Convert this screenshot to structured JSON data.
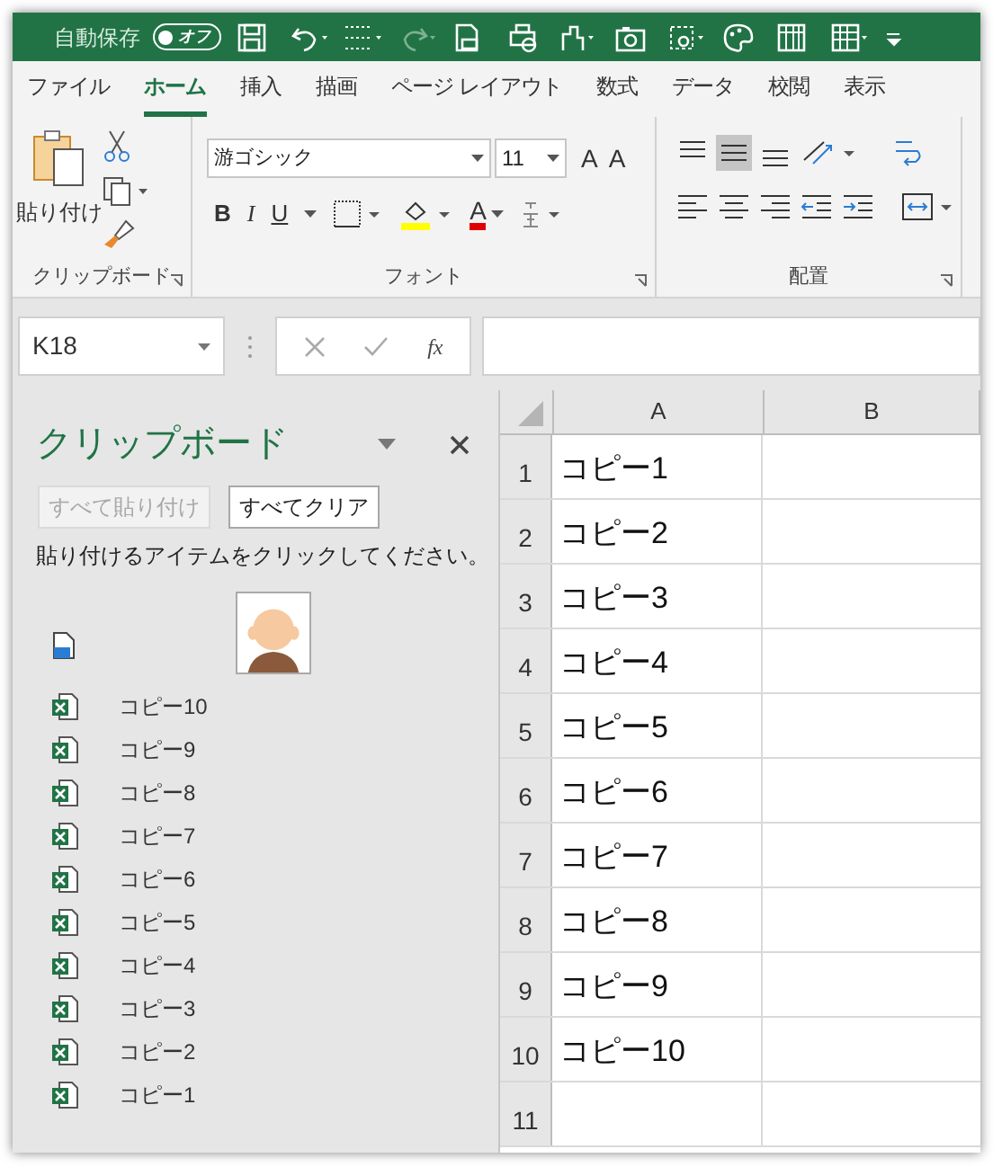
{
  "title_bar": {
    "autosave_label": "自動保存",
    "autosave_toggle": {
      "label": "オフ",
      "on": false
    }
  },
  "tabs": [
    {
      "label": "ファイル",
      "selected": false
    },
    {
      "label": "ホーム",
      "selected": true
    },
    {
      "label": "挿入",
      "selected": false
    },
    {
      "label": "描画",
      "selected": false
    },
    {
      "label": "ページ レイアウト",
      "selected": false
    },
    {
      "label": "数式",
      "selected": false
    },
    {
      "label": "データ",
      "selected": false
    },
    {
      "label": "校閲",
      "selected": false
    },
    {
      "label": "表示",
      "selected": false
    }
  ],
  "ribbon": {
    "clipboard": {
      "paste_label": "貼り付け",
      "group_label": "クリップボード"
    },
    "font": {
      "font_name": "游ゴシック",
      "font_size": "11",
      "grow": "A",
      "shrink": "A",
      "bold": "B",
      "italic": "I",
      "underline": "U",
      "font_color": "A",
      "group_label": "フォント"
    },
    "alignment": {
      "group_label": "配置"
    }
  },
  "formula_bar": {
    "name_box": "K18",
    "fx": "fx"
  },
  "clipboard_pane": {
    "title": "クリップボード",
    "buttons": [
      {
        "label": "すべて貼り付け",
        "disabled": true
      },
      {
        "label": "すべてクリア",
        "disabled": false
      }
    ],
    "instruction": "貼り付けるアイテムをクリックしてください。",
    "items": [
      {
        "kind": "picture"
      },
      {
        "kind": "excel",
        "label": "コピー10"
      },
      {
        "kind": "excel",
        "label": "コピー9"
      },
      {
        "kind": "excel",
        "label": "コピー8"
      },
      {
        "kind": "excel",
        "label": "コピー7"
      },
      {
        "kind": "excel",
        "label": "コピー6"
      },
      {
        "kind": "excel",
        "label": "コピー5"
      },
      {
        "kind": "excel",
        "label": "コピー4"
      },
      {
        "kind": "excel",
        "label": "コピー3"
      },
      {
        "kind": "excel",
        "label": "コピー2"
      },
      {
        "kind": "excel",
        "label": "コピー1"
      }
    ]
  },
  "sheet": {
    "columns": [
      "A",
      "B"
    ],
    "rows": [
      {
        "number": "1",
        "a": "コピー1"
      },
      {
        "number": "2",
        "a": "コピー2"
      },
      {
        "number": "3",
        "a": "コピー3"
      },
      {
        "number": "4",
        "a": "コピー4"
      },
      {
        "number": "5",
        "a": "コピー5"
      },
      {
        "number": "6",
        "a": "コピー6"
      },
      {
        "number": "7",
        "a": "コピー7"
      },
      {
        "number": "8",
        "a": "コピー8"
      },
      {
        "number": "9",
        "a": "コピー9"
      },
      {
        "number": "10",
        "a": "コピー10"
      },
      {
        "number": "11"
      }
    ]
  }
}
